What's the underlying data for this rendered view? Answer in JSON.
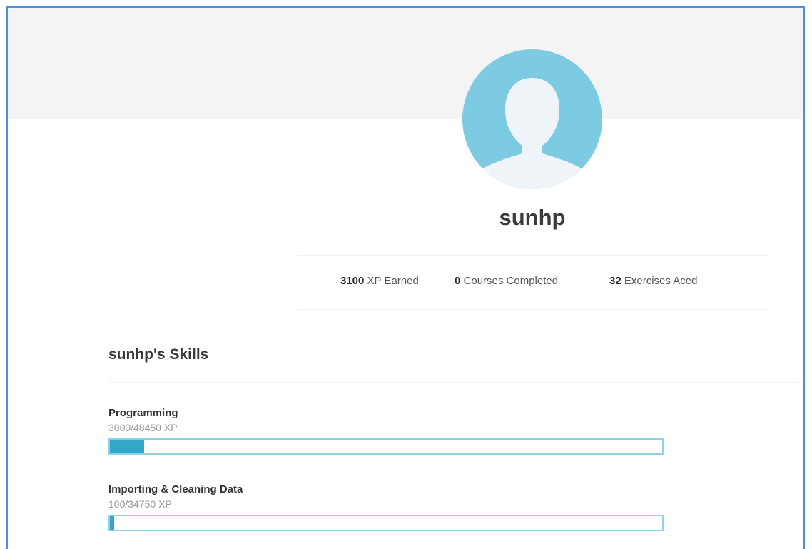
{
  "profile": {
    "username": "sunhp",
    "colors": {
      "avatar_bg": "#7ccbe3",
      "avatar_figure": "#eef4f7"
    }
  },
  "stats": [
    {
      "value": "3100",
      "label": "XP Earned"
    },
    {
      "value": "0",
      "label": "Courses Completed"
    },
    {
      "value": "32",
      "label": "Exercises Aced"
    }
  ],
  "skills_section": {
    "title": "sunhp's Skills",
    "items": [
      {
        "name": "Programming",
        "xp_text": "3000/48450 XP",
        "progress": 0.062
      },
      {
        "name": "Importing & Cleaning Data",
        "xp_text": "100/34750 XP",
        "progress": 0.003
      }
    ],
    "colors": {
      "bar_fill": "#33a6c9",
      "bar_border": "#8fd2e6"
    }
  }
}
